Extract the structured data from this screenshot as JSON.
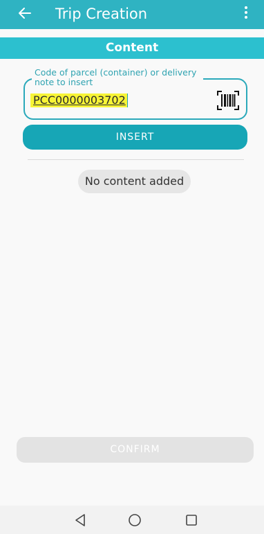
{
  "app_bar": {
    "title": "Trip Creation",
    "back_icon": "arrow-left-icon",
    "menu_icon": "more-vertical-icon"
  },
  "section": {
    "title": "Content"
  },
  "code_field": {
    "label": "Code of parcel (container) or delivery note to insert",
    "value": "PCC0000003702",
    "scan_icon": "barcode-scan-icon"
  },
  "insert_button": {
    "label": "INSERT"
  },
  "empty_state": {
    "text": "No content added"
  },
  "confirm_button": {
    "label": "CONFIRM",
    "enabled": false
  },
  "nav_bar": {
    "back_icon": "triangle-back-icon",
    "home_icon": "circle-home-icon",
    "recents_icon": "square-recents-icon"
  },
  "colors": {
    "app_bar": "#2fb3c2",
    "subheader": "#2cc0cf",
    "accent": "#17a6b6",
    "highlight": "#f7f437",
    "disabled": "#e3e3e3"
  }
}
